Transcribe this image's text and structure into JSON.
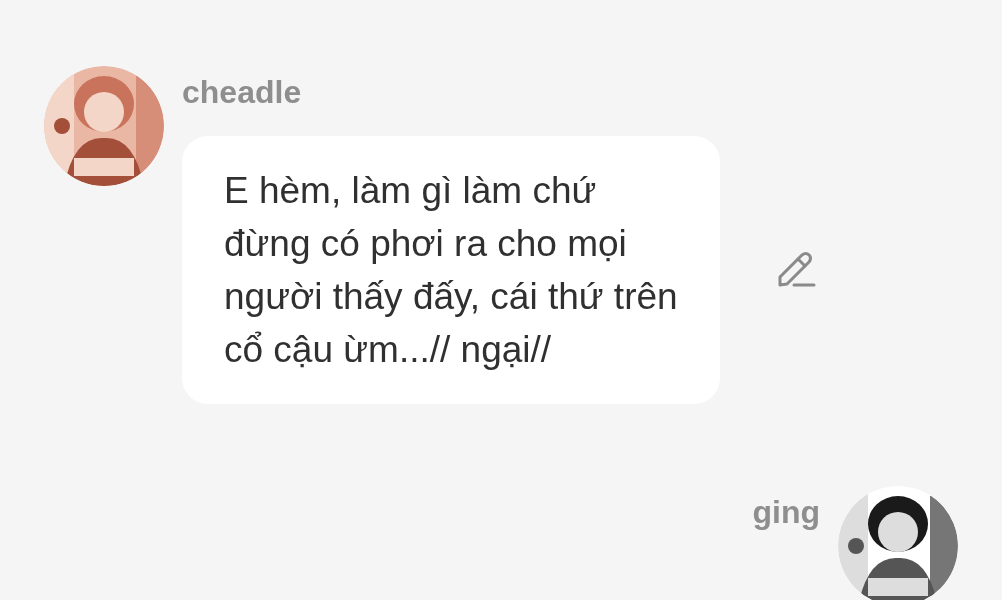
{
  "messages": [
    {
      "sender": "cheadle",
      "kind": "incoming",
      "text": "E hèm, làm gì làm chứ đừng có phơi ra cho mọi người thấy đấy, cái thứ trên cổ cậu ừm...// ngại//",
      "editable": true
    },
    {
      "sender": "ging",
      "kind": "outgoing"
    }
  ]
}
